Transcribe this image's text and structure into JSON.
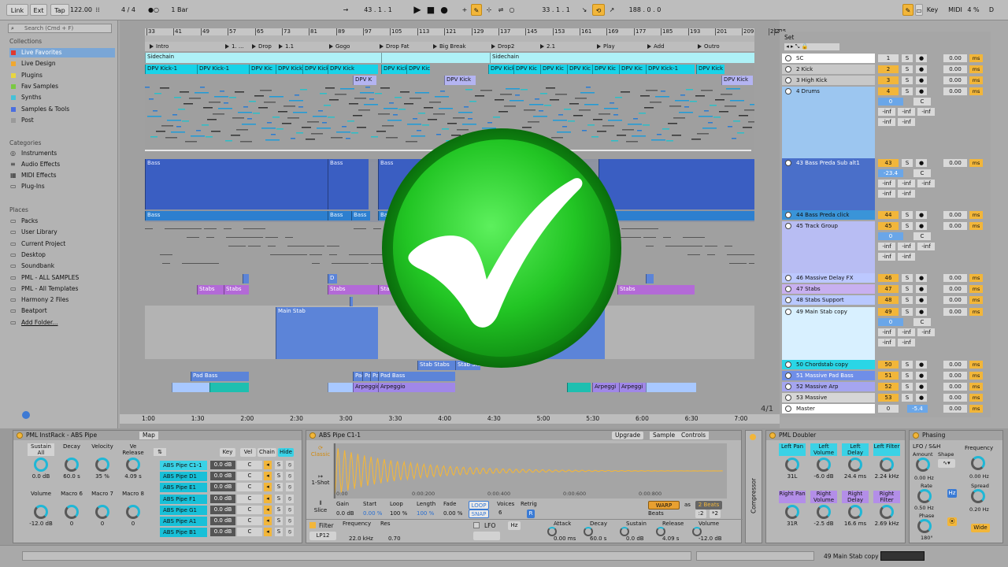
{
  "transport": {
    "link": "Link",
    "ext": "Ext",
    "tap": "Tap",
    "tempo": "122.00",
    "time_sig": "4 / 4",
    "quant": "1 Bar",
    "position": "43 .  1 .  1",
    "loop_start": "33 .  1 .  1",
    "loop_len": "188 .  0 .  0",
    "key": "Key",
    "midi": "MIDI",
    "cpu": "4 %",
    "d": "D"
  },
  "browser": {
    "search_placeholder": "Search (Cmd + F)",
    "collections_label": "Collections",
    "collections": [
      {
        "label": "Live Favorites",
        "color": "#e03a2f",
        "selected": true
      },
      {
        "label": "Live Design",
        "color": "#f0a830"
      },
      {
        "label": "Plugins",
        "color": "#e8d640"
      },
      {
        "label": "Fav Samples",
        "color": "#7ac943"
      },
      {
        "label": "Synths",
        "color": "#44c1d8"
      },
      {
        "label": "Samples & Tools",
        "color": "#4a6ee0"
      },
      {
        "label": "Post",
        "color": "#9a9a9a"
      }
    ],
    "categories_label": "Categories",
    "categories": [
      "Instruments",
      "Audio Effects",
      "MIDI Effects",
      "Plug-Ins"
    ],
    "places_label": "Places",
    "places": [
      "Packs",
      "User Library",
      "Current Project",
      "Desktop",
      "Soundbank",
      "PML - ALL SAMPLES",
      "PML - All Templates",
      "Harmony 2 Files",
      "Beatport",
      "Add Folder..."
    ]
  },
  "arrangement": {
    "ruler": [
      "33",
      "41",
      "49",
      "57",
      "65",
      "73",
      "81",
      "89",
      "97",
      "105",
      "113",
      "121",
      "129",
      "137",
      "145",
      "153",
      "161",
      "169",
      "177",
      "185",
      "193",
      "201",
      "209",
      "217",
      "225"
    ],
    "locators": [
      "Intro",
      "1. ...",
      "Drop",
      "1.1",
      "Gogo",
      "Drop Fat",
      "Big Break",
      "Drop2",
      "2.1",
      "Play",
      "Add",
      "Outro"
    ],
    "time_ruler": [
      "1:00",
      "1:30",
      "2:00",
      "2:30",
      "3:00",
      "3:30",
      "4:00",
      "4:30",
      "5:00",
      "5:30",
      "6:00",
      "6:30",
      "7:00"
    ],
    "zoom": "4/1",
    "clips": {
      "sidechain": "Sidechain",
      "kick": "DPV Kick-1",
      "kick_short": "DPV Kick",
      "kick_trunc": "DPV Kic",
      "kick_dpv": "DPV K",
      "bass": "Bass",
      "stabs": "Stabs",
      "main_stab": "Main Stab",
      "stab_stabs": "Stab Stabs",
      "pad_bass": "Pad Bass",
      "arpeggio": "Arpeggio",
      "arpegg": "Arpeggi",
      "d": "D"
    }
  },
  "mixer": {
    "set_label": "Set",
    "tracks": [
      {
        "name": "SC",
        "num": "1"
      },
      {
        "name": "2 Kick",
        "num": "2"
      },
      {
        "name": "3 High Kick",
        "num": "3"
      },
      {
        "name": "4 Drums",
        "num": "4"
      },
      {
        "name": "43 Bass Preda Sub alt1",
        "num": "43"
      },
      {
        "name": "44 Bass Preda click",
        "num": "44"
      },
      {
        "name": "45 Track Group",
        "num": "45"
      },
      {
        "name": "46 Massive Delay FX",
        "num": "46"
      },
      {
        "name": "47 Stabs",
        "num": "47"
      },
      {
        "name": "48 Stabs Support",
        "num": "48"
      },
      {
        "name": "49 Main Stab copy",
        "num": "49"
      },
      {
        "name": "50 Chordstab copy",
        "num": "50"
      },
      {
        "name": "51 Massive Pad Bass",
        "num": "51"
      },
      {
        "name": "52 Massive Arp",
        "num": "52"
      },
      {
        "name": "53 Massive",
        "num": "53"
      },
      {
        "name": "Master",
        "num": "0"
      }
    ],
    "solo": "S",
    "zero": "0",
    "c": "C",
    "inf": "-inf",
    "db": "0.00",
    "ms": "ms",
    "bass_vol": "-23.4",
    "master_vol": "-5.4"
  },
  "devices": {
    "instrack": {
      "title": "PML InstRack - ABS Pipe",
      "map": "Map",
      "macros": [
        {
          "label": "Sustain All",
          "value": "0.0 dB"
        },
        {
          "label": "Decay",
          "value": "60.0 s"
        },
        {
          "label": "Velocity",
          "value": "35 %"
        },
        {
          "label": "Ve Release",
          "value": "4.09 s"
        },
        {
          "label": "Volume",
          "value": "-12.0 dB"
        },
        {
          "label": "Macro 6",
          "value": "0"
        },
        {
          "label": "Macro 7",
          "value": "0"
        },
        {
          "label": "Macro 8",
          "value": "0"
        }
      ],
      "chain_tabs": [
        "Key",
        "Vel",
        "Chain",
        "Hide"
      ],
      "chains": [
        "ABS Pipe C1-1",
        "ABS Pipe D1",
        "ABS Pipe E1",
        "ABS Pipe F1",
        "ABS Pipe G1",
        "ABS Pipe A1",
        "ABS Pipe B1"
      ],
      "chain_vol": "0.0 dB",
      "chain_pan": "C",
      "chain_solo": "S"
    },
    "simpler": {
      "title": "ABS Pipe C1-1",
      "upgrade": "Upgrade",
      "sample": "Sample",
      "controls": "Controls",
      "modes": [
        "Classic",
        "1-Shot",
        "Slice"
      ],
      "times": [
        "0:00",
        "0:00:200",
        "0:00:400",
        "0:00:600",
        "0:00:800"
      ],
      "params": [
        {
          "label": "Gain",
          "value": "0.0 dB"
        },
        {
          "label": "Start",
          "value": "0.00 %"
        },
        {
          "label": "Loop",
          "value": "100 %"
        },
        {
          "label": "Length",
          "value": "100 %"
        },
        {
          "label": "Fade",
          "value": "0.00 %"
        }
      ],
      "loop": "LOOP",
      "snap": "SNAP",
      "voices_label": "Voices",
      "voices": "6",
      "retrig": "Retrig",
      "retrig_val": "R",
      "warp": "WARP",
      "as": "as",
      "beats_val": "2 Beats",
      "beats": "Beats",
      "half": ":2",
      "double": "*2",
      "filter": "Filter",
      "filter_type": "LP12",
      "freq_label": "Frequency",
      "freq": "22.0 kHz",
      "res_label": "Res",
      "res": "0.70",
      "lfo": "LFO",
      "hz": "Hz",
      "env": [
        {
          "label": "Attack",
          "value": "0.00 ms"
        },
        {
          "label": "Decay",
          "value": "60.0 s"
        },
        {
          "label": "Sustain",
          "value": "0.0 dB"
        },
        {
          "label": "Release",
          "value": "4.09 s"
        },
        {
          "label": "Volume",
          "value": "-12.0 dB"
        }
      ]
    },
    "compressor": "Compressor",
    "doubler": {
      "title": "PML Doubler",
      "macros": [
        {
          "label": "Left Pan",
          "value": "31L"
        },
        {
          "label": "Left Volume",
          "value": "-6.0 dB"
        },
        {
          "label": "Left Delay",
          "value": "24.4 ms"
        },
        {
          "label": "Left Filter",
          "value": "2.24 kHz"
        },
        {
          "label": "Right Pan",
          "value": "31R"
        },
        {
          "label": "Right Volume",
          "value": "-2.5 dB"
        },
        {
          "label": "Right Delay",
          "value": "16.6 ms"
        },
        {
          "label": "Right Filter",
          "value": "2.69 kHz"
        }
      ]
    },
    "phasing": {
      "title": "Phasing",
      "lfo": "LFO / S&H",
      "amount": "Amount",
      "shape": "Shape",
      "amount_val": "0.00 Hz",
      "rate": "Rate",
      "rate_val": "0.50 Hz",
      "phase": "Phase",
      "phase_val": "180°",
      "freq": "Frequency",
      "freq_val": "0.00 Hz",
      "spread": "Spread",
      "spread_val": "0.20 Hz",
      "wide": "Wide",
      "hz": "Hz"
    }
  },
  "status": {
    "track": "49 Main Stab copy"
  }
}
